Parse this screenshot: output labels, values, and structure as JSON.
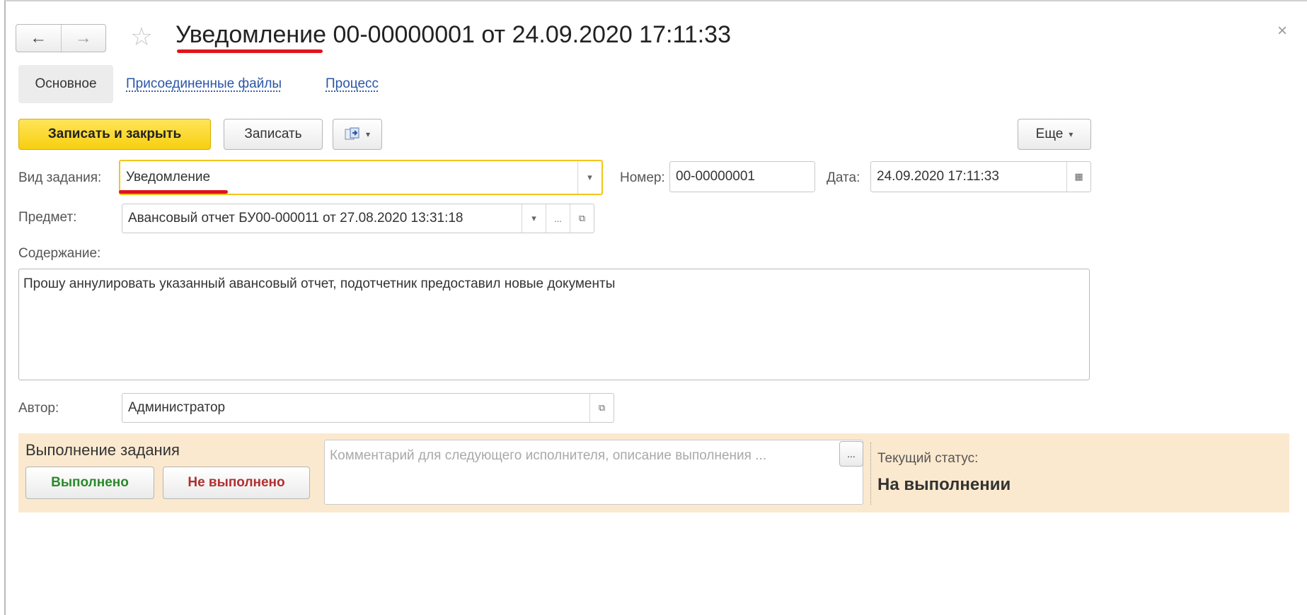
{
  "window": {
    "title": "Уведомление 00-00000001 от 24.09.2020 17:11:33",
    "back_icon": "←",
    "forward_icon": "→",
    "star_icon": "☆",
    "close_icon": "×"
  },
  "tabs": {
    "main": "Основное",
    "attached_files": "Присоединенные файлы",
    "process": "Процесс"
  },
  "toolbar": {
    "save_close_label": "Записать и закрыть",
    "save_label": "Записать",
    "more_label": "Еще",
    "dropdown_caret": "▾"
  },
  "form": {
    "task_type_label": "Вид задания:",
    "task_type_value": "Уведомление",
    "number_label": "Номер:",
    "number_value": "00-00000001",
    "date_label": "Дата:",
    "date_value": "24.09.2020 17:11:33",
    "subject_label": "Предмет:",
    "subject_value": "Авансовый отчет БУ00-000011 от 27.08.2020 13:31:18",
    "content_label": "Содержание:",
    "content_value": "Прошу аннулировать указанный авансовый отчет, подотчетник предоставил новые документы",
    "author_label": "Автор:",
    "author_value": "Администратор",
    "ellipsis": "...",
    "open_icon": "⧉",
    "calendar_icon": "▦"
  },
  "execution": {
    "title": "Выполнение задания",
    "done_label": "Выполнено",
    "not_done_label": "Не выполнено",
    "comment_placeholder": "Комментарий для следующего исполнителя, описание выполнения ...",
    "current_status_label": "Текущий статус:",
    "current_status_value": "На выполнении"
  },
  "colors": {
    "accent_yellow": "#f7cf0f",
    "link_blue": "#2a56a6",
    "panel_bg": "#fbe9cf",
    "underline_red": "#e0141b",
    "done_green": "#2a8a2a",
    "not_done_red": "#b03030"
  }
}
